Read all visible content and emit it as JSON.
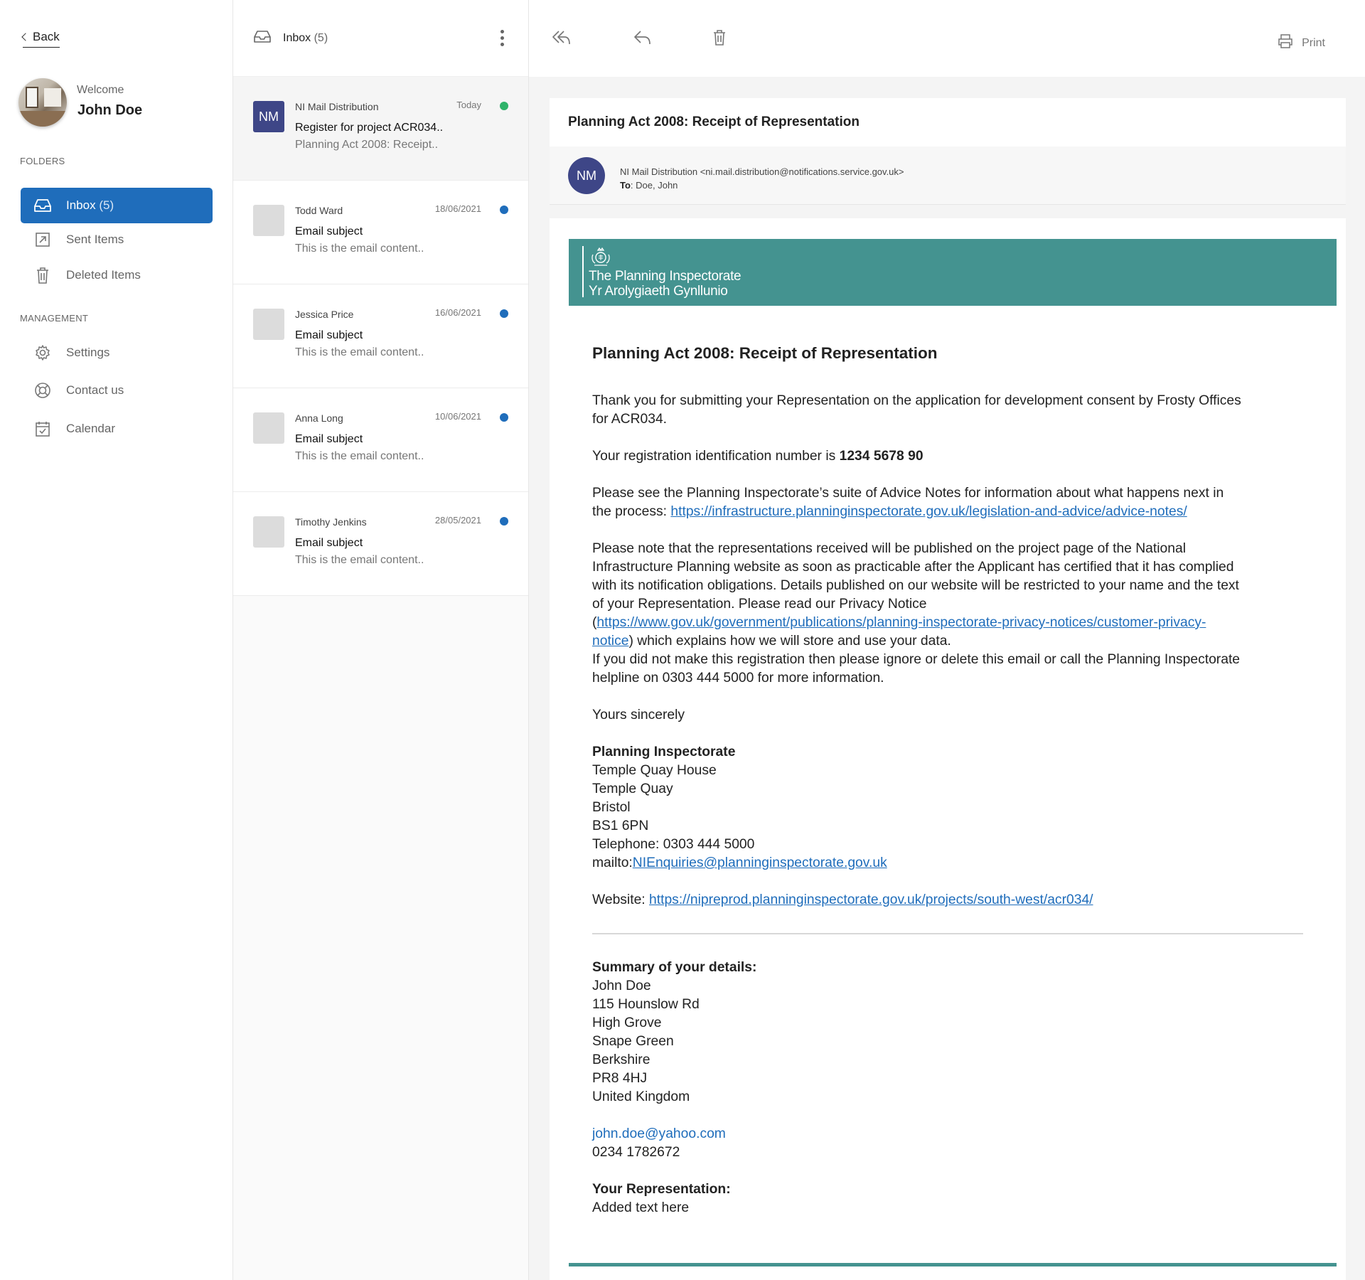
{
  "sidebar": {
    "back_label": "Back",
    "welcome": "Welcome",
    "username": "John Doe",
    "folders_label": "FOLDERS",
    "management_label": "MANAGEMENT",
    "folders": [
      {
        "label": "Inbox",
        "count": "(5)",
        "icon": "inbox-icon"
      },
      {
        "label": "Sent Items",
        "count": "",
        "icon": "sent-icon"
      },
      {
        "label": "Deleted Items",
        "count": "",
        "icon": "trash-icon"
      }
    ],
    "management": [
      {
        "label": "Settings",
        "icon": "gear-icon"
      },
      {
        "label": "Contact us",
        "icon": "lifebuoy-icon"
      },
      {
        "label": "Calendar",
        "icon": "calendar-icon"
      }
    ]
  },
  "list": {
    "title": "Inbox",
    "count": "(5)",
    "messages": [
      {
        "initials": "NM",
        "sender": "NI Mail Distribution",
        "date": "Today",
        "subject": "Register for project ACR034..",
        "preview": "Planning Act 2008: Receipt..",
        "unread_color": "#2fb36a"
      },
      {
        "initials": "",
        "sender": "Todd Ward",
        "date": "18/06/2021",
        "subject": "Email subject",
        "preview": "This is the email content..",
        "unread_color": "#1f6dbb"
      },
      {
        "initials": "",
        "sender": "Jessica Price",
        "date": "16/06/2021",
        "subject": "Email subject",
        "preview": "This is the email content..",
        "unread_color": "#1f6dbb"
      },
      {
        "initials": "",
        "sender": "Anna Long",
        "date": "10/06/2021",
        "subject": "Email subject",
        "preview": "This is the email content..",
        "unread_color": "#1f6dbb"
      },
      {
        "initials": "",
        "sender": "Timothy Jenkins",
        "date": "28/05/2021",
        "subject": "Email subject",
        "preview": "This is the email content..",
        "unread_color": "#1f6dbb"
      }
    ]
  },
  "reader": {
    "print_label": "Print",
    "subject": "Planning Act 2008: Receipt of Representation",
    "from_initials": "NM",
    "from": "NI Mail Distribution <ni.mail.distribution@notifications.service.gov.uk>",
    "to_label": "To",
    "to": ": Doe, John",
    "banner": {
      "line1": "The Planning Inspectorate",
      "line2": "Yr Arolygiaeth Gynllunio"
    },
    "body": {
      "heading": "Planning Act 2008: Receipt of Representation",
      "p1": "Thank you for submitting your Representation on the application for development consent by Frosty Offices for ACR034.",
      "p2_prefix": "Your registration identification number is ",
      "p2_number": "1234 5678 90",
      "p3_prefix": "Please see the Planning Inspectorate’s suite of Advice Notes for information about what happens next in the process: ",
      "p3_link": "https://infrastructure.planninginspectorate.gov.uk/legislation-and-advice/advice-notes/",
      "p4_prefix": "Please note that the representations received will be published on the project page of the National Infrastructure Planning website as soon as practicable after the Applicant has certified that it has complied with its notification obligations. Details published on our website will be restricted to your name and the text of your Representation. Please read our Privacy Notice (",
      "p4_link": "https://www.gov.uk/government/publications/planning-inspectorate-privacy-notices/customer-privacy-notice",
      "p4_suffix": ") which explains how we will store and use your data.",
      "p5": "If you did not make this registration then please ignore or delete this email or call the Planning Inspectorate helpline on 0303 444 5000 for more information.",
      "signoff": "Yours sincerely",
      "org_name": "Planning Inspectorate",
      "address": [
        "Temple Quay House",
        "Temple Quay",
        "Bristol",
        "BS1 6PN"
      ],
      "telephone": "Telephone: 0303 444 5000",
      "mailto_prefix": "mailto:",
      "mailto_link": "NIEnquiries@planninginspectorate.gov.uk",
      "website_prefix": "Website: ",
      "website_link": "https://nipreprod.planninginspectorate.gov.uk/projects/south-west/acr034/",
      "summary_label": "Summary of your details:",
      "summary_lines": [
        "John Doe",
        "115 Hounslow Rd",
        "High Grove",
        "Snape Green",
        "Berkshire",
        "PR8 4HJ",
        "United Kingdom"
      ],
      "email": "john.doe@yahoo.com",
      "phone": "0234 1782672",
      "representation_label": "Your Representation:",
      "representation_text": "Added text here"
    }
  },
  "colors": {
    "accent": "#1f6dbb",
    "banner": "#449390",
    "avatar": "#3e4687"
  }
}
